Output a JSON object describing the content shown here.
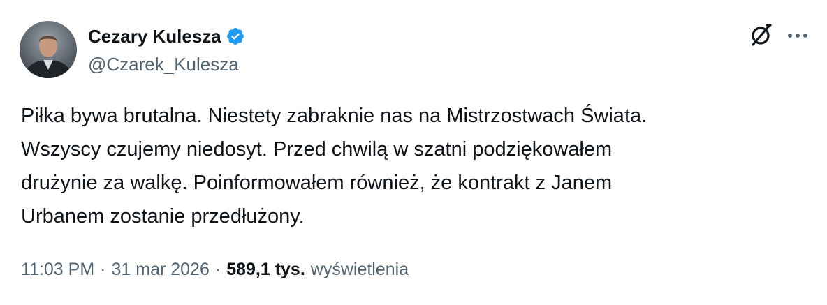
{
  "author": {
    "display_name": "Cezary Kulesza",
    "handle": "@Czarek_Kulesza",
    "verified": true,
    "verified_color": "#1d9bf0"
  },
  "icons": {
    "verified": "verified-badge-icon",
    "grok": "grok-icon",
    "more": "more-options-icon"
  },
  "tweet": {
    "text": "Piłka bywa brutalna. Niestety zabraknie nas na Mistrzostwach Świata.\nWszyscy czujemy niedosyt. Przed chwilą w szatni podziękowałem\ndrużynie za walkę. Poinformowałem również, że kontrakt z Janem\nUrbanem zostanie przedłużony.",
    "time": "11:03 PM",
    "date": "31 mar 2026",
    "separator": "·",
    "views_count": "589,1 tys.",
    "views_label": "wyświetlenia"
  },
  "colors": {
    "text_primary": "#0f1419",
    "text_secondary": "#536471",
    "background": "#ffffff"
  }
}
